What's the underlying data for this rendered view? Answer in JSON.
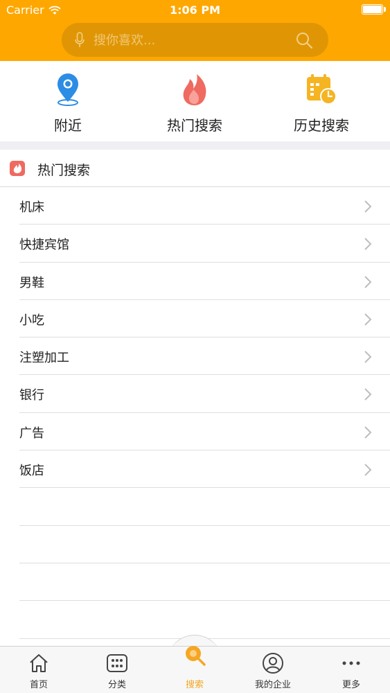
{
  "status_bar": {
    "carrier": "Carrier",
    "time": "1:06 PM"
  },
  "search": {
    "placeholder": "搜你喜欢..."
  },
  "quick_actions": [
    {
      "label": "附近",
      "icon": "location-pin-icon"
    },
    {
      "label": "热门搜索",
      "icon": "flame-icon"
    },
    {
      "label": "历史搜索",
      "icon": "calendar-clock-icon"
    }
  ],
  "hot_section": {
    "title": "热门搜索",
    "icon": "flame-badge-icon"
  },
  "hot_items": [
    "机床",
    "快捷宾馆",
    "男鞋",
    "小吃",
    "注塑加工",
    "银行",
    "广告",
    "饭店"
  ],
  "tabs": [
    {
      "label": "首页",
      "icon": "home-icon"
    },
    {
      "label": "分类",
      "icon": "grid-dots-icon"
    },
    {
      "label": "搜索",
      "icon": "search-icon",
      "active": true
    },
    {
      "label": "我的企业",
      "icon": "user-icon"
    },
    {
      "label": "更多",
      "icon": "more-dots-icon"
    }
  ],
  "colors": {
    "brand": "#fea701",
    "accent": "#f5a623",
    "hot": "#ef6a60",
    "location": "#2b8de4"
  }
}
